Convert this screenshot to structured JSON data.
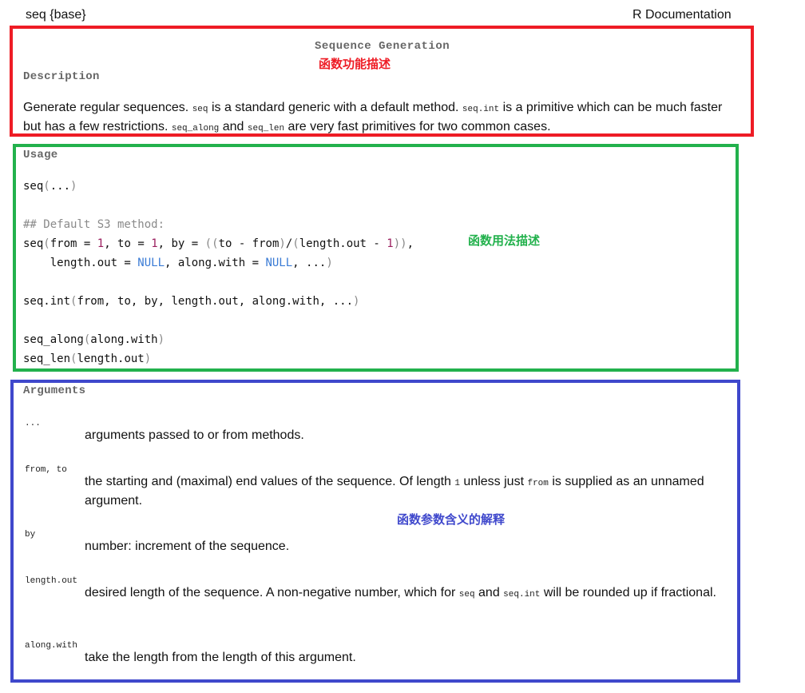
{
  "header": {
    "left": "seq {base}",
    "right": "R Documentation"
  },
  "title": "Sequence Generation",
  "annotations": {
    "description": "函数功能描述",
    "usage": "函数用法描述",
    "arguments": "函数参数含义的解释"
  },
  "annotation_colors": {
    "description": "#ee1c25",
    "usage": "#22b14c",
    "arguments": "#3f48cc"
  },
  "description": {
    "heading": "Description",
    "parts": [
      "Generate regular sequences. ",
      "seq",
      " is a standard generic with a default method. ",
      "seq.int",
      " is a primitive which can be much faster but has a few restrictions. ",
      "seq_along",
      " and ",
      "seq_len",
      " are very fast primitives for two common cases."
    ]
  },
  "usage": {
    "heading": "Usage",
    "lines": [
      "seq(...)",
      "## Default S3 method:",
      "seq(from = 1, to = 1, by = ((to - from)/(length.out - 1)),",
      "    length.out = NULL, along.with = NULL, ...)",
      "seq.int(from, to, by, length.out, along.with, ...)",
      "seq_along(along.with)",
      "seq_len(length.out)"
    ]
  },
  "arguments": {
    "heading": "Arguments",
    "items": [
      {
        "name": "...",
        "desc": "arguments passed to or from methods."
      },
      {
        "name": "from, to",
        "desc_parts": [
          "the starting and (maximal) end values of the sequence. Of length ",
          "1",
          " unless just ",
          "from",
          " is supplied as an unnamed argument."
        ]
      },
      {
        "name": "by",
        "desc": "number: increment of the sequence."
      },
      {
        "name": "length.out",
        "desc_parts": [
          "desired length of the sequence. A non-negative number, which for ",
          "seq",
          " and ",
          "seq.int",
          " will be rounded up if fractional."
        ]
      },
      {
        "name": "along.with",
        "desc": "take the length from the length of this argument."
      }
    ]
  }
}
